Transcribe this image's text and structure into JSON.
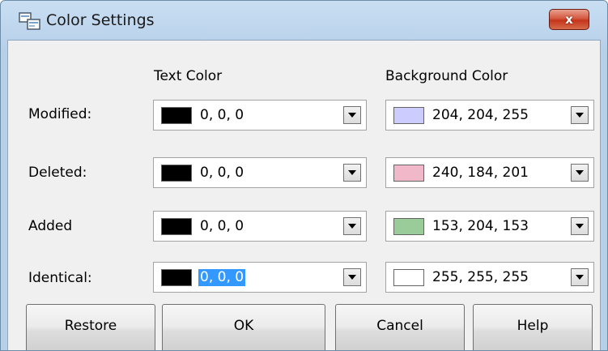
{
  "window": {
    "title": "Color Settings",
    "app_icon": "compare-windows-icon",
    "close_icon": "close-icon",
    "close_label": "x"
  },
  "headers": {
    "text_color": "Text Color",
    "background_color": "Background Color"
  },
  "rows": [
    {
      "label": "Modified:",
      "text_color": {
        "value": "0, 0, 0",
        "swatch": "#000000",
        "selected": false
      },
      "background_color": {
        "value": "204, 204, 255",
        "swatch": "#ccccff"
      }
    },
    {
      "label": "Deleted:",
      "text_color": {
        "value": "0, 0, 0",
        "swatch": "#000000",
        "selected": false
      },
      "background_color": {
        "value": "240, 184, 201",
        "swatch": "#f0b8c9"
      }
    },
    {
      "label": "Added",
      "text_color": {
        "value": "0, 0, 0",
        "swatch": "#000000",
        "selected": false
      },
      "background_color": {
        "value": "153, 204, 153",
        "swatch": "#99cc99"
      }
    },
    {
      "label": "Identical:",
      "text_color": {
        "value": "0, 0, 0",
        "swatch": "#000000",
        "selected": true
      },
      "background_color": {
        "value": "255, 255, 255",
        "swatch": "#ffffff"
      }
    }
  ],
  "buttons": {
    "restore": "Restore",
    "ok": "OK",
    "cancel": "Cancel",
    "help": "Help"
  },
  "colors": {
    "selection": "#3399ff",
    "close_button": "#c4341a"
  }
}
